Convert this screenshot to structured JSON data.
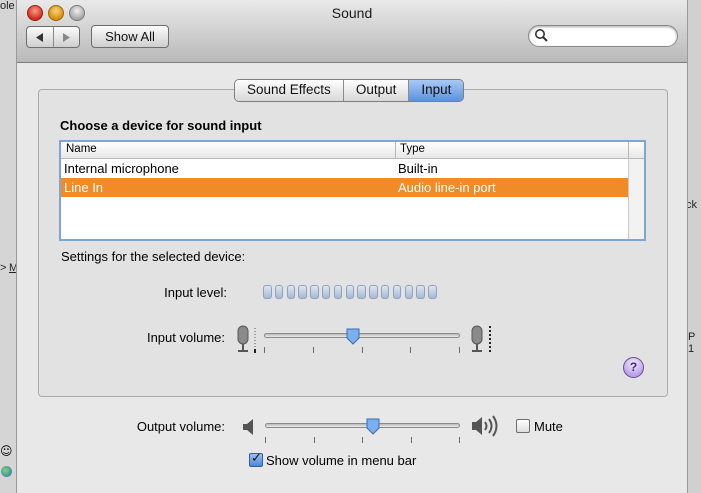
{
  "window": {
    "title": "Sound"
  },
  "toolbar": {
    "back_icon": "triangle-left-icon",
    "forward_icon": "triangle-right-icon",
    "show_all_label": "Show All",
    "search": {
      "value": "",
      "placeholder": ""
    }
  },
  "tabs": [
    {
      "label": "Sound Effects",
      "active": false
    },
    {
      "label": "Output",
      "active": false
    },
    {
      "label": "Input",
      "active": true
    }
  ],
  "input": {
    "heading": "Choose a device for sound input",
    "columns": [
      "Name",
      "Type"
    ],
    "devices": [
      {
        "name": "Internal microphone",
        "type": "Built-in",
        "selected": false
      },
      {
        "name": "Line In",
        "type": "Audio line-in port",
        "selected": true
      }
    ],
    "settings_heading": "Settings for the selected device:",
    "input_level_label": "Input level:",
    "input_level_segments": 15,
    "input_level_lit": 0,
    "input_volume_label": "Input volume:",
    "input_volume_value": 0.45
  },
  "output": {
    "volume_label": "Output volume:",
    "volume_value": 0.55,
    "mute_label": "Mute",
    "mute_checked": false,
    "show_volume_label": "Show volume in menu bar",
    "show_volume_checked": true
  },
  "help_label": "?",
  "colors": {
    "selection": "#f28b26",
    "active_tab": "#5b92e0"
  },
  "background_app": {
    "fragments": [
      "ole",
      "ck l",
      "P 1",
      ">",
      "M"
    ]
  }
}
